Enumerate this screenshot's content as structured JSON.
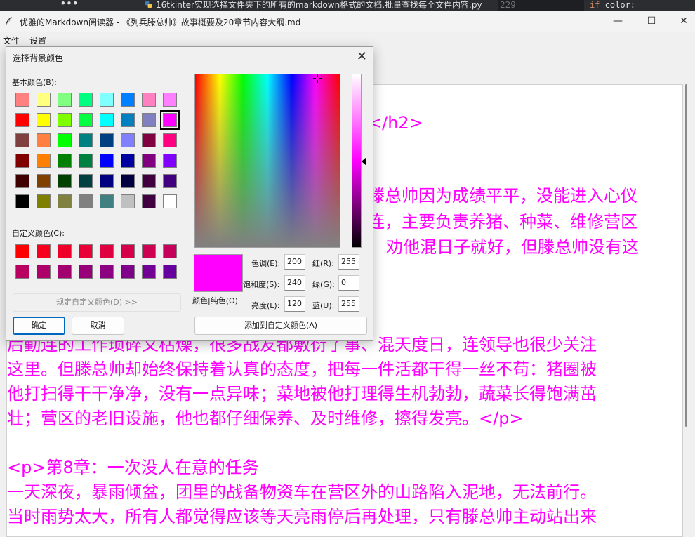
{
  "ide_strip": {
    "more": "•••",
    "tab_title": "16tkinter实现选择文件夹下的所有的markdown格式的文档,批量查找每个文件内容.py",
    "line_number": "229",
    "code_keyword": "if",
    "code_text": " color:"
  },
  "window": {
    "title": "优雅的Markdown阅读器 - 《列兵滕总帅》故事概要及20章节内容大纲.md",
    "minimize": "—",
    "maximize": "☐",
    "close": "✕"
  },
  "menu": {
    "file": "文件",
    "settings": "设置"
  },
  "content_lines": [
    "</h2>",
    "滕总帅因为成绩平平，没能进入心仪",
    "连，主要负责养猪、种菜、维修营区",
    "劝他混日子就好，但滕总帅没有这",
    "后勤连的工作琐碎又枯燥，很多战友都敷衍了事、混天度日，连领导也很少关注",
    "这里。但滕总帅却始终保持着认真的态度，把每一件活都干得一丝不苟：猪圈被",
    "他打扫得干干净净，没有一点异味；菜地被他打理得生机勃勃，蔬菜长得饱满茁",
    "壮；营区的老旧设施，他也都仔细保养、及时维修，擦得发亮。</p>",
    "<p>第8章：一次没人在意的任务",
    "一天深夜，暴雨倾盆，团里的战备物资车在营区外的山路陷入泥地，无法前行。",
    "当时雨势太大，所有人都觉得应该等天亮雨停后再处理，只有滕总帅主动站出来"
  ],
  "dialog": {
    "title": "选择背景颜色",
    "close": "✕",
    "basic_colors_label": "基本颜色(B):",
    "custom_colors_label": "自定义颜色(C):",
    "define_custom_button": "规定自定义颜色(D) >>",
    "ok_button": "确定",
    "cancel_button": "取消",
    "add_custom_button": "添加到自定义颜色(A)",
    "preview_label": "颜色|纯色(O)",
    "hue_label": "色调(E):",
    "hue_value": "200",
    "sat_label": "饱和度(S):",
    "sat_value": "240",
    "lum_label": "亮度(L):",
    "lum_value": "120",
    "red_label": "红(R):",
    "red_value": "255",
    "green_label": "绿(G):",
    "green_value": "0",
    "blue_label": "蓝(U):",
    "blue_value": "255",
    "selected_color": "#ff00ff",
    "basic_colors": [
      [
        "#ff8080",
        "#ffff80",
        "#80ff80",
        "#00ff80",
        "#80ffff",
        "#0080ff",
        "#ff80c0",
        "#ff80ff"
      ],
      [
        "#ff0000",
        "#ffff00",
        "#80ff00",
        "#00ff40",
        "#00ffff",
        "#0080c0",
        "#8080c0",
        "#ff00ff"
      ],
      [
        "#804040",
        "#ff8040",
        "#00ff00",
        "#008080",
        "#004080",
        "#8080ff",
        "#800040",
        "#ff0080"
      ],
      [
        "#800000",
        "#ff8000",
        "#008000",
        "#008040",
        "#0000ff",
        "#0000a0",
        "#800080",
        "#8000ff"
      ],
      [
        "#400000",
        "#804000",
        "#004000",
        "#004040",
        "#000080",
        "#000040",
        "#400040",
        "#400080"
      ],
      [
        "#000000",
        "#808000",
        "#808040",
        "#808080",
        "#408080",
        "#c0c0c0",
        "#400040",
        "#ffffff"
      ]
    ],
    "custom_colors": [
      [
        "#ff0000",
        "#f6001c",
        "#ef002a",
        "#e80036",
        "#df0040",
        "#d6004a",
        "#ce0052",
        "#c6005a"
      ],
      [
        "#b80060",
        "#ad0068",
        "#a2006f",
        "#970078",
        "#8c0082",
        "#7e008b",
        "#730094",
        "#66009e"
      ]
    ]
  }
}
